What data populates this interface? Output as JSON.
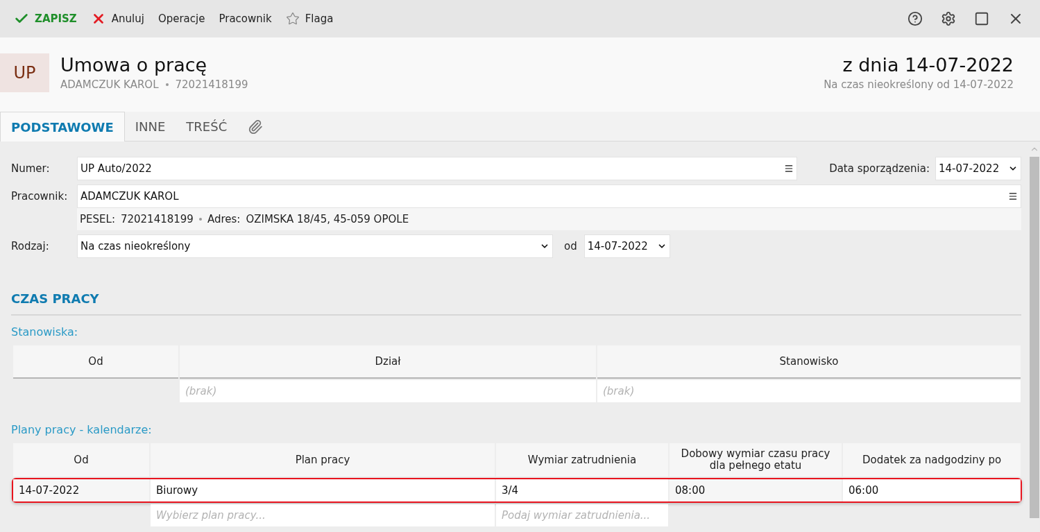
{
  "toolbar": {
    "items": [
      {
        "kind": "save",
        "label": "ZAPISZ"
      },
      {
        "kind": "cancel",
        "label": "Anuluj"
      },
      {
        "kind": "plain",
        "label": "Operacje"
      },
      {
        "kind": "plain",
        "label": "Pracownik"
      },
      {
        "kind": "flag",
        "label": "Flaga"
      }
    ]
  },
  "header": {
    "badge": "UP",
    "title": "Umowa o pracę",
    "employee": "ADAMCZUK KAROL",
    "pesel": "72021418199",
    "date_title": "z dnia 14-07-2022",
    "date_subtitle": "Na czas nieokreślony od 14-07-2022"
  },
  "tabs": [
    {
      "label": "PODSTAWOWE",
      "selected": true
    },
    {
      "label": "INNE",
      "selected": false
    },
    {
      "label": "TREŚĆ",
      "selected": false
    },
    {
      "kind": "attachments",
      "selected": false
    }
  ],
  "form": {
    "numer": {
      "label": "Numer:",
      "value": "UP Auto/2022"
    },
    "data_sporzadzenia": {
      "label": "Data sporządzenia:",
      "value": "14-07-2022"
    },
    "pracownik": {
      "label": "Pracownik:",
      "value": "ADAMCZUK KAROL"
    },
    "info": {
      "pesel_label": "PESEL:",
      "pesel": "72021418199",
      "address_label": "Adres:",
      "address": "OZIMSKA 18/45, 45-059 OPOLE"
    },
    "rodzaj": {
      "label": "Rodzaj:",
      "value": "Na czas nieokreślony"
    },
    "od": {
      "label": "od",
      "value": "14-07-2022"
    }
  },
  "section_title": "CZAS PRACY",
  "stanowiska": {
    "title": "Stanowiska:",
    "columns": [
      "Od",
      "Dział",
      "Stanowisko"
    ],
    "new_row": [
      {
        "kind": "blank"
      },
      {
        "kind": "placeholder",
        "placeholder": "(brak)"
      },
      {
        "kind": "placeholder",
        "placeholder": "(brak)"
      }
    ]
  },
  "plany": {
    "title": "Plany pracy - kalendarze:",
    "columns": [
      "Od",
      "Plan pracy",
      "Wymiar zatrudnienia",
      "Dobowy wymiar czasu pracy dla pełnego etatu",
      "Dodatek za nadgodziny po"
    ],
    "rows": [
      {
        "selected": true,
        "cells": [
          {
            "kind": "readonly",
            "value": "14-07-2022"
          },
          {
            "kind": "editable",
            "value": "Biurowy"
          },
          {
            "kind": "editable",
            "value": "3/4"
          },
          {
            "kind": "readonly",
            "value": "08:00"
          },
          {
            "kind": "editable",
            "value": "06:00"
          }
        ]
      }
    ],
    "new_row": [
      {
        "kind": "blank"
      },
      {
        "kind": "placeholder",
        "placeholder": "Wybierz plan pracy..."
      },
      {
        "kind": "placeholder",
        "placeholder": "Podaj wymiar zatrudnienia..."
      },
      {
        "kind": "blank"
      },
      {
        "kind": "blank"
      }
    ]
  }
}
